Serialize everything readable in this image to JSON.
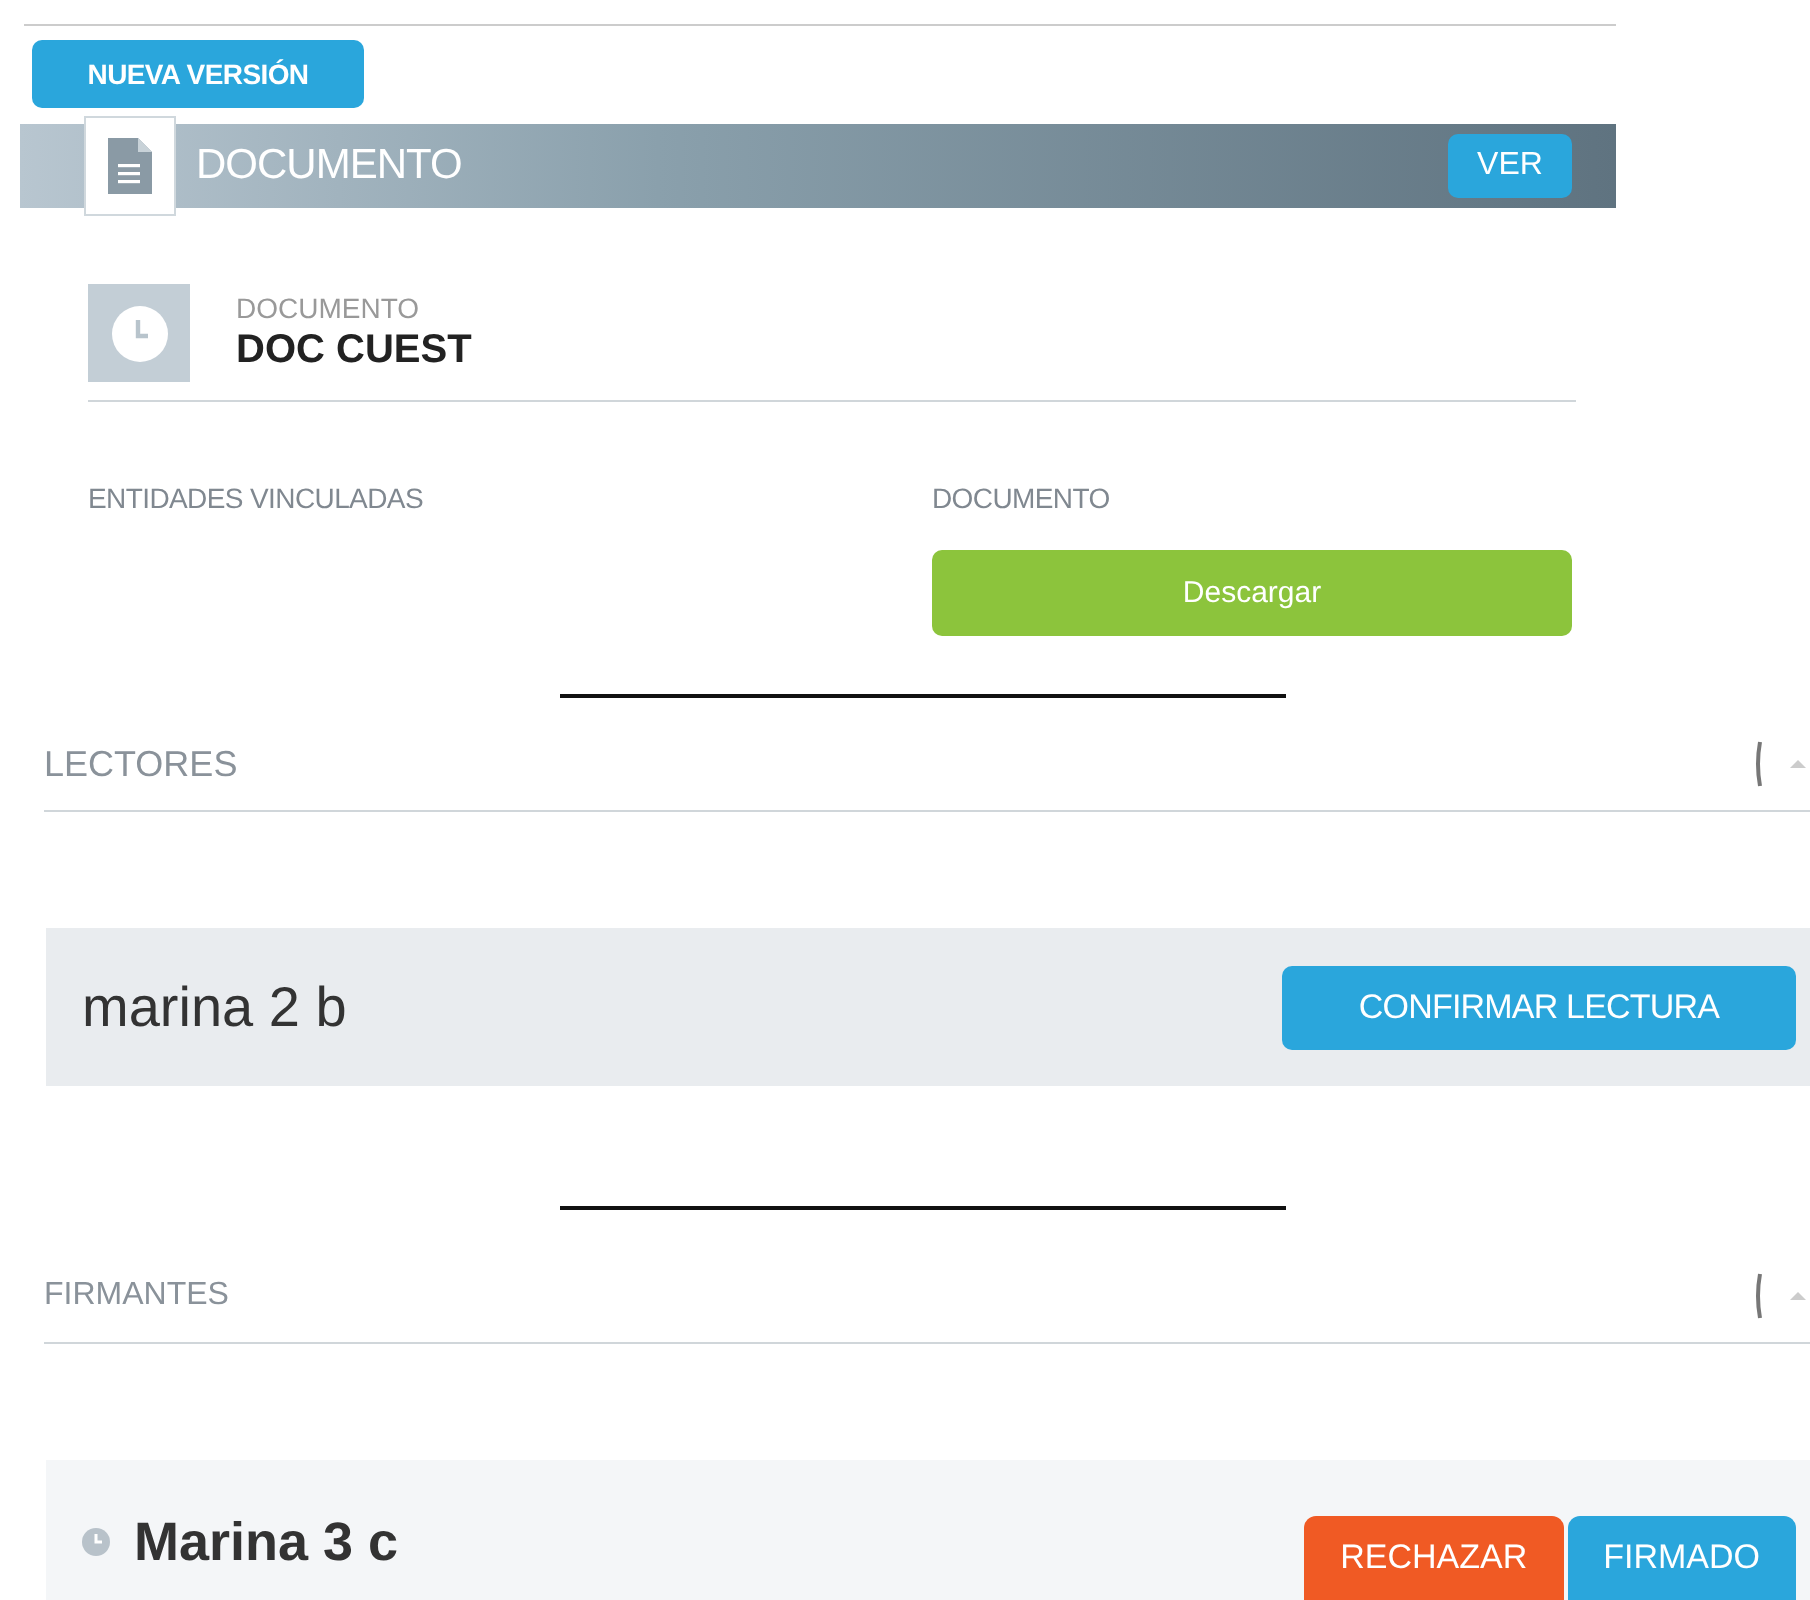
{
  "new_version_button": "NUEVA VERSIÓN",
  "header": {
    "title": "DOCUMENTO",
    "view_button": "VER"
  },
  "detail": {
    "label": "DOCUMENTO",
    "value": "DOC CUEST"
  },
  "linked": {
    "entities_label": "ENTIDADES VINCULADAS",
    "document_label": "DOCUMENTO",
    "download_button": "Descargar"
  },
  "readers": {
    "title": "LECTORES",
    "items": [
      {
        "name": "marina 2 b",
        "confirm_button": "CONFIRMAR LECTURA"
      }
    ]
  },
  "signers": {
    "title": "FIRMANTES",
    "items": [
      {
        "name": "Marina 3 c",
        "reject_button": "RECHAZAR",
        "sign_button": "FIRMADO"
      }
    ]
  }
}
